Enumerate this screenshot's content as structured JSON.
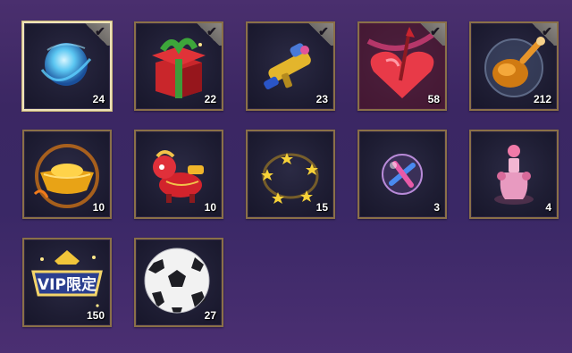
{
  "inventory": {
    "items": [
      {
        "icon": "blue-orb-icon",
        "count": "24",
        "owned_check": true,
        "selected": true
      },
      {
        "icon": "gift-box-icon",
        "count": "22",
        "owned_check": true
      },
      {
        "icon": "water-gun-icon",
        "count": "23",
        "owned_check": true
      },
      {
        "icon": "pierced-heart-icon",
        "count": "58",
        "owned_check": true
      },
      {
        "icon": "roast-chicken-bubble-icon",
        "count": "212",
        "owned_check": true
      },
      {
        "icon": "gold-ingot-icon",
        "count": "10"
      },
      {
        "icon": "fortune-horse-icon",
        "count": "10"
      },
      {
        "icon": "star-ring-icon",
        "count": "15"
      },
      {
        "icon": "cross-bubble-icon",
        "count": "3"
      },
      {
        "icon": "pink-perfume-bottle-icon",
        "count": "4"
      },
      {
        "icon": "vip-badge-icon",
        "count": "150",
        "badge_text": "VIP限定"
      },
      {
        "icon": "soccer-ball-icon",
        "count": "27"
      }
    ],
    "check_glyph": "✔"
  }
}
